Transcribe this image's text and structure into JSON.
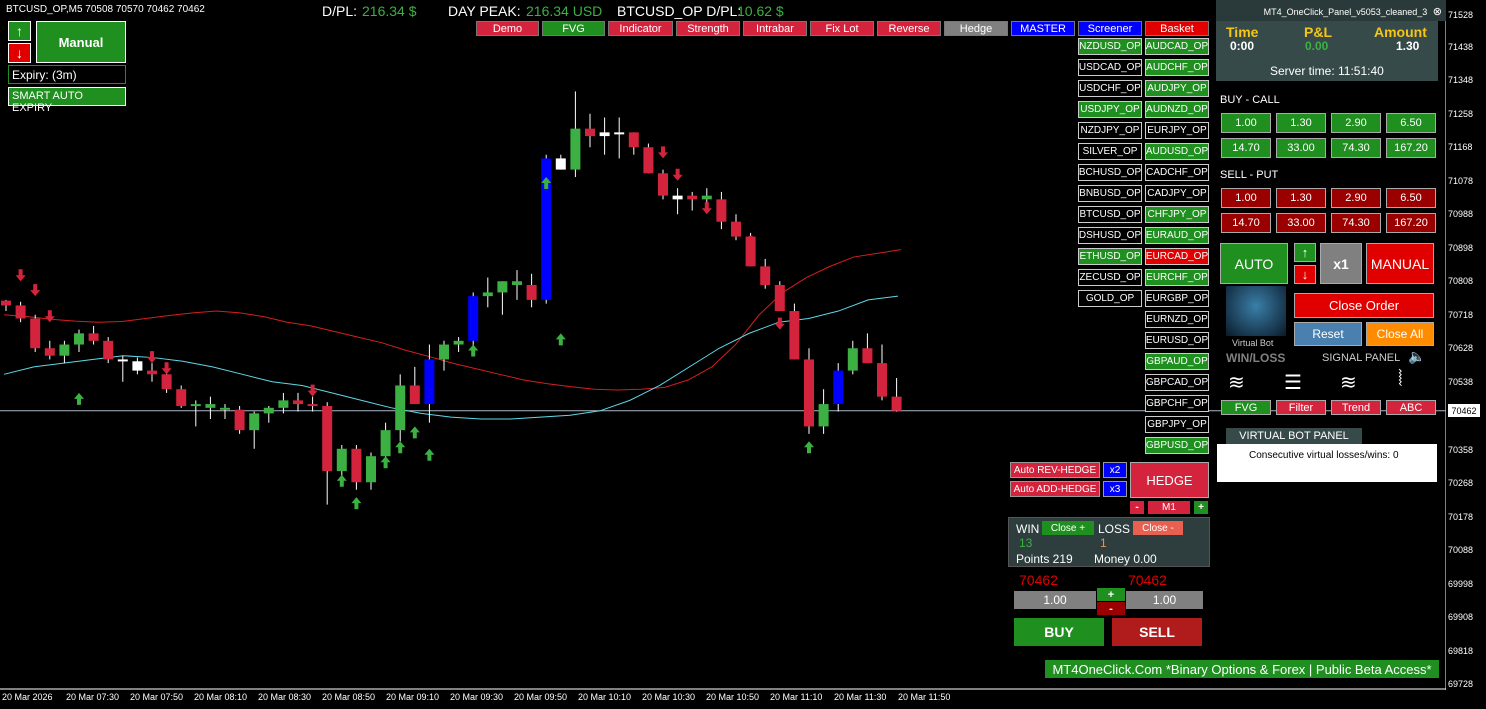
{
  "header": {
    "symbol_line": "BTCUSD_OP,M5  70508 70570 70462 70462",
    "dpl_label": "D/PL:",
    "dpl_value": "216.34 $",
    "peak_label": "DAY PEAK:",
    "peak_value": "216.34 USD",
    "sym_dpl_label": "BTCUSD_OP D/PL:",
    "sym_dpl_value": "10.62 $"
  },
  "left_panel": {
    "up_arrow": "↑",
    "down_arrow": "↓",
    "manual_label": "Manual",
    "expiry_label": "Expiry: (3m)",
    "smart_expiry_label": "SMART AUTO EXPIRY"
  },
  "toolbar": [
    {
      "label": "Demo",
      "color": "#d4243d"
    },
    {
      "label": "FVG",
      "color": "#1f8f1f"
    },
    {
      "label": "Indicator",
      "color": "#d4243d"
    },
    {
      "label": "Strength",
      "color": "#d4243d"
    },
    {
      "label": "Intrabar",
      "color": "#d4243d"
    },
    {
      "label": "Fix Lot",
      "color": "#d4243d"
    },
    {
      "label": "Reverse",
      "color": "#d4243d"
    },
    {
      "label": "Hedge",
      "color": "#808080"
    },
    {
      "label": "MASTER",
      "color": "#0000ff"
    },
    {
      "label": "Screener",
      "color": "#0000ff"
    },
    {
      "label": "Basket",
      "color": "#e00000"
    }
  ],
  "pairs_col1": [
    {
      "label": "NZDUSD_OP",
      "state": "g"
    },
    {
      "label": "USDCAD_OP",
      "state": ""
    },
    {
      "label": "USDCHF_OP",
      "state": ""
    },
    {
      "label": "USDJPY_OP",
      "state": "g"
    },
    {
      "label": "NZDJPY_OP",
      "state": ""
    },
    {
      "label": "SILVER_OP",
      "state": ""
    },
    {
      "label": "BCHUSD_OP",
      "state": ""
    },
    {
      "label": "BNBUSD_OP",
      "state": ""
    },
    {
      "label": "BTCUSD_OP",
      "state": ""
    },
    {
      "label": "DSHUSD_OP",
      "state": ""
    },
    {
      "label": "ETHUSD_OP",
      "state": "g"
    },
    {
      "label": "ZECUSD_OP",
      "state": ""
    },
    {
      "label": "GOLD_OP",
      "state": ""
    }
  ],
  "pairs_col2": [
    {
      "label": "AUDCAD_OP",
      "state": "g"
    },
    {
      "label": "AUDCHF_OP",
      "state": "g"
    },
    {
      "label": "AUDJPY_OP",
      "state": "g"
    },
    {
      "label": "AUDNZD_OP",
      "state": "g"
    },
    {
      "label": "EURJPY_OP",
      "state": ""
    },
    {
      "label": "AUDUSD_OP",
      "state": "g"
    },
    {
      "label": "CADCHF_OP",
      "state": ""
    },
    {
      "label": "CADJPY_OP",
      "state": ""
    },
    {
      "label": "CHFJPY_OP",
      "state": "g"
    },
    {
      "label": "EURAUD_OP",
      "state": "g"
    },
    {
      "label": "EURCAD_OP",
      "state": "r"
    },
    {
      "label": "EURCHF_OP",
      "state": "g"
    },
    {
      "label": "EURGBP_OP",
      "state": ""
    },
    {
      "label": "EURNZD_OP",
      "state": ""
    },
    {
      "label": "EURUSD_OP",
      "state": ""
    },
    {
      "label": "GBPAUD_OP",
      "state": "g"
    },
    {
      "label": "GBPCAD_OP",
      "state": ""
    },
    {
      "label": "GBPCHF_OP",
      "state": ""
    },
    {
      "label": "GBPJPY_OP",
      "state": ""
    },
    {
      "label": "GBPUSD_OP",
      "state": "g"
    }
  ],
  "right_panel": {
    "window_title": "MT4_OneClick_Panel_v5053_cleaned_3",
    "time_label": "Time",
    "time_value": "0:00",
    "pl_label": "P&L",
    "pl_value": "0.00",
    "amount_label": "Amount",
    "amount_value": "1.30",
    "server_time": "Server time:  11:51:40",
    "buy_label": "BUY - CALL",
    "sell_label": "SELL - PUT",
    "buy_amounts": [
      "1.00",
      "1.30",
      "2.90",
      "6.50",
      "14.70",
      "33.00",
      "74.30",
      "167.20"
    ],
    "sell_amounts": [
      "1.00",
      "1.30",
      "2.90",
      "6.50",
      "14.70",
      "33.00",
      "74.30",
      "167.20"
    ],
    "auto_label": "AUTO",
    "x1_label": "x1",
    "manual_label": "MANUAL",
    "close_order_label": "Close Order",
    "reset_label": "Reset",
    "close_all_label": "Close All",
    "virtual_bot_label": "Virtual Bot",
    "winloss_label": "WIN/LOSS",
    "signal_panel_label": "SIGNAL PANEL",
    "filters": [
      "FVG",
      "Filter",
      "Trend",
      "ABC"
    ],
    "vbot_panel_label": "VIRTUAL BOT PANEL",
    "vbot_text": "Consecutive virtual losses/wins: 0"
  },
  "hedge_panel": {
    "rev_hedge": "Auto REV-HEDGE",
    "rev_mult": "x2",
    "add_hedge": "Auto ADD-HEDGE",
    "add_mult": "x3",
    "hedge_label": "HEDGE",
    "minus": "-",
    "tf": "M1",
    "plus": "+"
  },
  "winloss_panel": {
    "win_label": "WIN",
    "close_plus": "Close +",
    "loss_label": "LOSS",
    "close_minus": "Close -",
    "wins": "13",
    "losses": "1",
    "points": "Points 219",
    "money": "Money 0.00"
  },
  "trade_panel": {
    "bid": "70462",
    "ask": "70462",
    "lot_left": "1.00",
    "lot_right": "1.00",
    "plus": "+",
    "minus": "-",
    "buy": "BUY",
    "sell": "SELL"
  },
  "banner": "MT4OneClick.Com *Binary Options & Forex | Public Beta Access*",
  "price_axis": [
    "71528",
    "71438",
    "71348",
    "71258",
    "71168",
    "71078",
    "70988",
    "70898",
    "70808",
    "70718",
    "70628",
    "70538",
    "70462",
    "70358",
    "70268",
    "70178",
    "70088",
    "69998",
    "69908",
    "69818",
    "69728"
  ],
  "current_price": "70462",
  "time_axis": [
    "20 Mar 2026",
    "20 Mar 07:30",
    "20 Mar 07:50",
    "20 Mar 08:10",
    "20 Mar 08:30",
    "20 Mar 08:50",
    "20 Mar 09:10",
    "20 Mar 09:30",
    "20 Mar 09:50",
    "20 Mar 10:10",
    "20 Mar 10:30",
    "20 Mar 10:50",
    "20 Mar 11:10",
    "20 Mar 11:30",
    "20 Mar 11:50"
  ],
  "colors": {
    "bull": "#3cb043",
    "bear": "#d4243d",
    "blue": "#0000ff",
    "ma_red": "#d41f1f",
    "ma_cyan": "#5fd8e8"
  },
  "chart_data": {
    "type": "candlestick",
    "price_min": 69728,
    "price_max": 71528,
    "candles": [
      [
        70758,
        70760,
        70730,
        70745
      ],
      [
        70745,
        70755,
        70700,
        70710
      ],
      [
        70710,
        70720,
        70620,
        70630
      ],
      [
        70630,
        70650,
        70600,
        70610
      ],
      [
        70610,
        70650,
        70590,
        70640
      ],
      [
        70640,
        70680,
        70620,
        70670
      ],
      [
        70670,
        70690,
        70640,
        70650
      ],
      [
        70650,
        70660,
        70590,
        70600
      ],
      [
        70600,
        70610,
        70540,
        70595
      ],
      [
        70595,
        70605,
        70560,
        70570
      ],
      [
        70570,
        70590,
        70540,
        70560
      ],
      [
        70560,
        70570,
        70510,
        70520
      ],
      [
        70520,
        70530,
        70470,
        70475
      ],
      [
        70475,
        70490,
        70420,
        70480
      ],
      [
        70480,
        70500,
        70440,
        70470
      ],
      [
        70470,
        70480,
        70440,
        70465
      ],
      [
        70465,
        70475,
        70400,
        70410
      ],
      [
        70410,
        70460,
        70360,
        70455
      ],
      [
        70455,
        70475,
        70430,
        70470
      ],
      [
        70470,
        70510,
        70455,
        70490
      ],
      [
        70490,
        70510,
        70460,
        70480
      ],
      [
        70480,
        70500,
        70460,
        70475
      ],
      [
        70475,
        70485,
        70210,
        70300
      ],
      [
        70300,
        70370,
        70260,
        70360
      ],
      [
        70360,
        70370,
        70250,
        70270
      ],
      [
        70270,
        70350,
        70250,
        70340
      ],
      [
        70340,
        70430,
        70320,
        70410
      ],
      [
        70410,
        70560,
        70380,
        70530
      ],
      [
        70530,
        70580,
        70480,
        70480
      ],
      [
        70480,
        70640,
        70430,
        70600
      ],
      [
        70600,
        70650,
        70570,
        70640
      ],
      [
        70640,
        70660,
        70620,
        70650
      ],
      [
        70650,
        70780,
        70630,
        70770
      ],
      [
        70770,
        70820,
        70740,
        70780
      ],
      [
        70780,
        70810,
        70720,
        70810
      ],
      [
        70810,
        70840,
        70760,
        70800
      ],
      [
        70800,
        70830,
        70740,
        70760
      ],
      [
        70760,
        71150,
        70750,
        71140
      ],
      [
        71140,
        71150,
        71110,
        71110
      ],
      [
        71110,
        71320,
        71090,
        71220
      ],
      [
        71220,
        71260,
        71170,
        71200
      ],
      [
        71200,
        71250,
        71150,
        71210
      ],
      [
        71210,
        71250,
        71140,
        71210
      ],
      [
        71210,
        71210,
        71150,
        71170
      ],
      [
        71170,
        71180,
        71100,
        71100
      ],
      [
        71100,
        71110,
        71030,
        71040
      ],
      [
        71040,
        71060,
        70990,
        71030
      ],
      [
        71030,
        71050,
        71000,
        71040
      ],
      [
        71040,
        71060,
        71000,
        71030
      ],
      [
        71030,
        71050,
        70950,
        70970
      ],
      [
        70970,
        70990,
        70920,
        70930
      ],
      [
        70930,
        70940,
        70850,
        70850
      ],
      [
        70850,
        70870,
        70790,
        70800
      ],
      [
        70800,
        70810,
        70730,
        70730
      ],
      [
        70730,
        70750,
        70600,
        70600
      ],
      [
        70600,
        70630,
        70400,
        70420
      ],
      [
        70420,
        70520,
        70400,
        70480
      ],
      [
        70480,
        70590,
        70460,
        70570
      ],
      [
        70570,
        70650,
        70560,
        70630
      ],
      [
        70630,
        70670,
        70590,
        70590
      ],
      [
        70590,
        70640,
        70490,
        70500
      ],
      [
        70500,
        70550,
        70460,
        70462
      ]
    ],
    "candle_colors": [
      "r",
      "r",
      "r",
      "r",
      "g",
      "g",
      "r",
      "r",
      "w",
      "w",
      "r",
      "r",
      "r",
      "g",
      "g",
      "g",
      "r",
      "g",
      "g",
      "g",
      "r",
      "r",
      "r",
      "g",
      "r",
      "g",
      "g",
      "g",
      "r",
      "b",
      "g",
      "g",
      "b",
      "g",
      "g",
      "g",
      "r",
      "b",
      "w",
      "g",
      "r",
      "w",
      "w",
      "r",
      "r",
      "r",
      "w",
      "r",
      "g",
      "r",
      "r",
      "r",
      "r",
      "r",
      "r",
      "r",
      "g",
      "b",
      "g",
      "r",
      "r",
      "r"
    ],
    "ma_red": [
      70720,
      70715,
      70708,
      70703,
      70700,
      70702,
      70710,
      70718,
      70725,
      70730,
      70725,
      70715,
      70700,
      70690,
      70675,
      70660,
      70645,
      70625,
      70608,
      70590,
      70575,
      70560,
      70545,
      70535,
      70527,
      70520,
      70518,
      70520,
      70525,
      70545,
      70580,
      70640,
      70720,
      70780,
      70820,
      70850,
      70875,
      70885,
      70895
    ],
    "ma_cyan": [
      70560,
      70580,
      70590,
      70600,
      70610,
      70605,
      70595,
      70580,
      70560,
      70540,
      70530,
      70510,
      70490,
      70470,
      70455,
      70445,
      70440,
      70440,
      70445,
      70450,
      70462,
      70490,
      70530,
      70580,
      70630,
      70670,
      70700,
      70710,
      70730,
      70760,
      70770
    ],
    "signals_up": [
      [
        5,
        70510
      ],
      [
        23,
        70290
      ],
      [
        24,
        70230
      ],
      [
        26,
        70340
      ],
      [
        27,
        70380
      ],
      [
        28,
        70420
      ],
      [
        29,
        70360
      ],
      [
        32,
        70640
      ],
      [
        37,
        71090
      ],
      [
        38,
        70670
      ],
      [
        55,
        70380
      ]
    ],
    "signals_down": [
      [
        1,
        70810
      ],
      [
        2,
        70770
      ],
      [
        3,
        70700
      ],
      [
        10,
        70590
      ],
      [
        11,
        70560
      ],
      [
        21,
        70500
      ],
      [
        45,
        71140
      ],
      [
        46,
        71080
      ],
      [
        48,
        70990
      ],
      [
        51,
        70900
      ],
      [
        53,
        70680
      ]
    ]
  }
}
